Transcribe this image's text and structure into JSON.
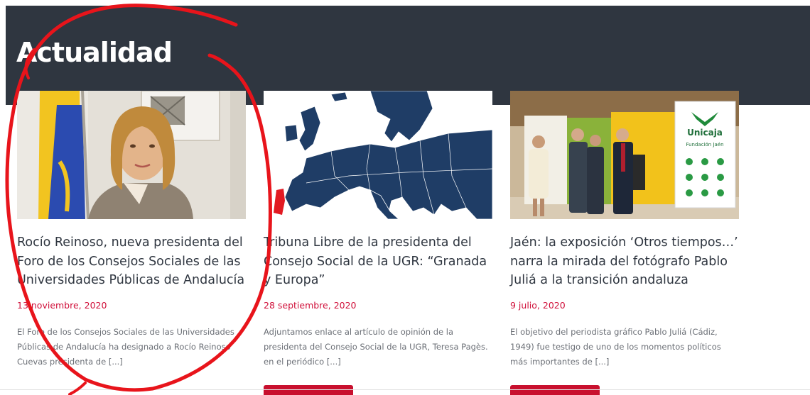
{
  "section": {
    "title": "Actualidad"
  },
  "articles": [
    {
      "title": "Rocío Reinoso, nueva presidenta del Foro de los Consejos Sociales de las Universidades Públicas de Andalucía",
      "date": "13 noviembre, 2020",
      "excerpt": "El Foro de los Consejos Sociales de las Universidades Públicas de Andalucía ha designado a Rocío Reinoso Cuevas presidenta de [...]"
    },
    {
      "title": "Tribuna Libre de la presidenta del Consejo Social de la UGR: “Granada y Europa”",
      "date": "28 septiembre, 2020",
      "excerpt": "Adjuntamos enlace al artículo de opinión de la presidenta del Consejo Social de la UGR, Teresa Pagès. en el periódico [...]"
    },
    {
      "title": "Jaén: la exposición ‘Otros tiempos…’ narra la mirada del fotógrafo Pablo Juliá a la transición andaluza",
      "date": "9 julio, 2020",
      "excerpt": "El objetivo del periodista gráfico Pablo Juliá (Cádiz, 1949) fue testigo de uno de los momentos políticos más importantes de [...]"
    }
  ],
  "image_text": {
    "banner_brand": "Unicaja",
    "banner_sub": "Fundación Jaén"
  },
  "colors": {
    "hero_bg": "#2f3640",
    "date": "#d0103a",
    "button": "#c8102e",
    "annotation": "#e8141b"
  }
}
